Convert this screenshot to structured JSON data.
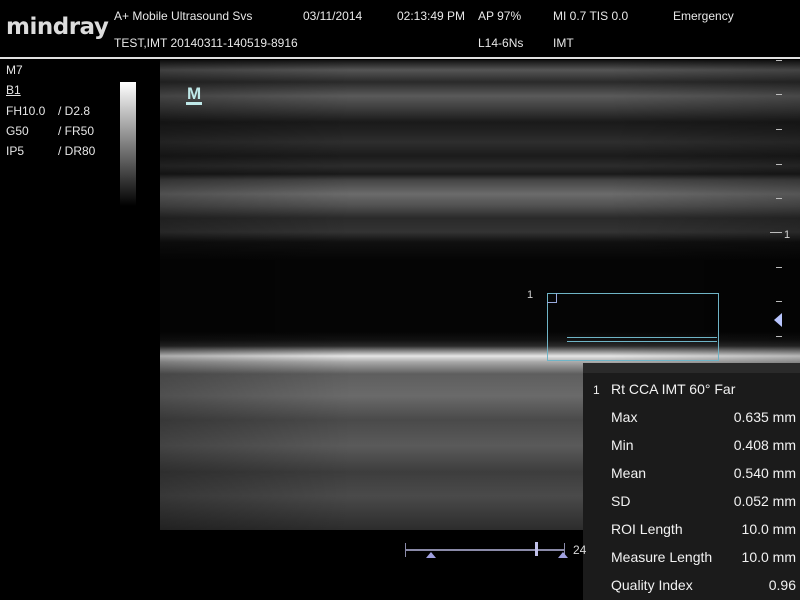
{
  "header": {
    "brand": "mindray",
    "institution": "A+ Mobile Ultrasound Svs",
    "date": "03/11/2014",
    "time": "02:13:49 PM",
    "acoustic_power": "AP  97%",
    "mi_tis": "MI 0.7  TIS 0.0",
    "preset_status": "Emergency",
    "patient_id": "TEST,IMT 20140311-140519-8916",
    "probe": "L14-6Ns",
    "exam_mode": "IMT"
  },
  "params": {
    "mode": "M7",
    "b_mode": "B1",
    "frequency": "FH10.0",
    "depth": "D2.8",
    "gain": "G50",
    "frame_rate": "FR50",
    "image_process": "IP5",
    "dynamic_range": "DR80"
  },
  "image": {
    "orientation_marker": "M",
    "depth_marker_label": "1",
    "roi_number": "1"
  },
  "measurement": {
    "index": "1",
    "title": "Rt CCA IMT 60° Far",
    "rows": [
      {
        "label": "Max",
        "value": "0.635 mm"
      },
      {
        "label": "Min",
        "value": "0.408 mm"
      },
      {
        "label": "Mean",
        "value": "0.540 mm"
      },
      {
        "label": "SD",
        "value": "0.052 mm"
      },
      {
        "label": "ROI Length",
        "value": "10.0 mm"
      },
      {
        "label": "Measure Length",
        "value": "10.0 mm"
      },
      {
        "label": "Quality Index",
        "value": "0.96"
      }
    ]
  },
  "cine": {
    "frame_label": "24"
  },
  "colors": {
    "roi_box": "#6fb4c6",
    "focus_marker": "#b9c6ff",
    "scroll_accent": "#a0a0e0"
  }
}
